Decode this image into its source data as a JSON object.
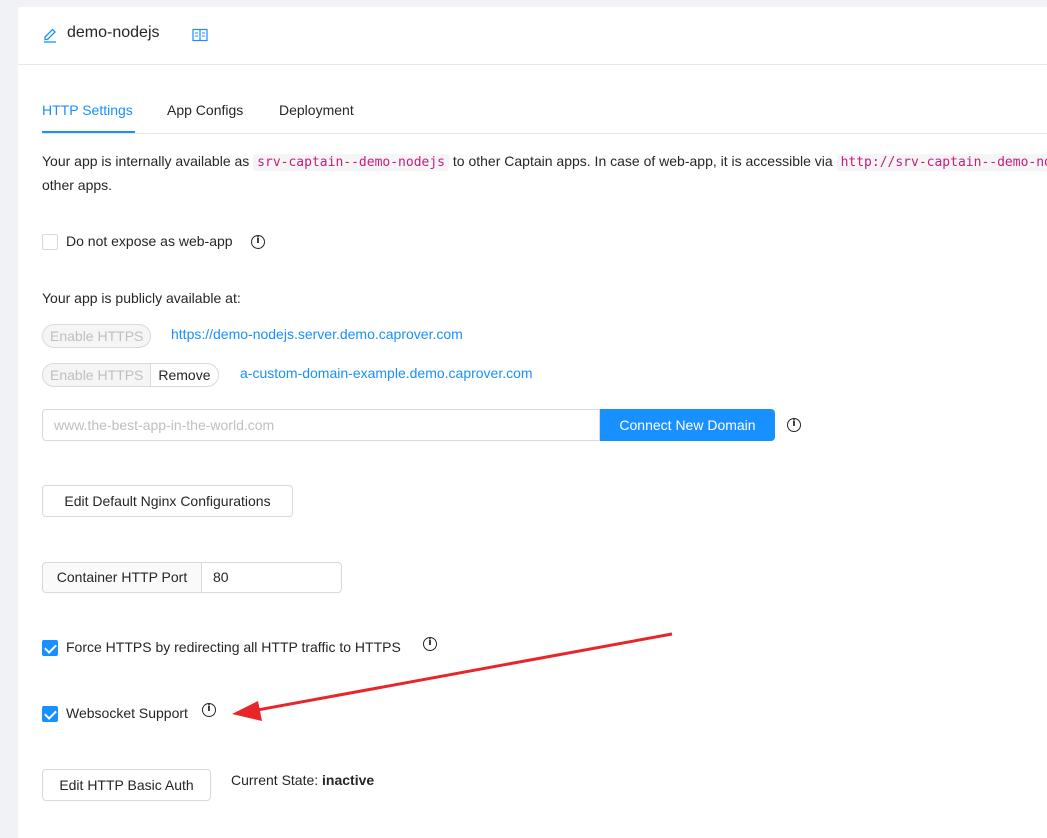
{
  "header": {
    "title": "demo-nodejs",
    "edit_icon": "pencil-icon",
    "docs_icon": "book-icon"
  },
  "tabs": [
    {
      "label": "HTTP Settings",
      "active": true
    },
    {
      "label": "App Configs",
      "active": false
    },
    {
      "label": "Deployment",
      "active": false
    }
  ],
  "intro": {
    "part1": "Your app is internally available as ",
    "code1": "srv-captain--demo-nodejs",
    "part2": " to other Captain apps. In case of web-app, it is accessible via ",
    "code2": "http://srv-captain--demo-nodejs",
    "line2": "other apps."
  },
  "no_expose": {
    "label": "Do not expose as web-app",
    "checked": false
  },
  "public_title": "Your app is publicly available at:",
  "domains": [
    {
      "enable_label": "Enable HTTPS",
      "url": "https://demo-nodejs.server.demo.caprover.com"
    },
    {
      "enable_label": "Enable HTTPS",
      "remove_label": "Remove",
      "url": "a-custom-domain-example.demo.caprover.com"
    }
  ],
  "new_domain": {
    "placeholder": "www.the-best-app-in-the-world.com",
    "button": "Connect New Domain"
  },
  "nginx_button": "Edit Default Nginx Configurations",
  "port": {
    "label": "Container HTTP Port",
    "value": "80"
  },
  "force_https": {
    "label": "Force HTTPS by redirecting all HTTP traffic to HTTPS",
    "checked": true
  },
  "websocket": {
    "label": "Websocket Support",
    "checked": true
  },
  "basic_auth": {
    "button": "Edit HTTP Basic Auth",
    "state_label": "Current State: ",
    "state_value": "inactive"
  },
  "colors": {
    "primary": "#1890ff",
    "annotation_arrow": "#e8262a",
    "code_text": "#c41d7f"
  }
}
